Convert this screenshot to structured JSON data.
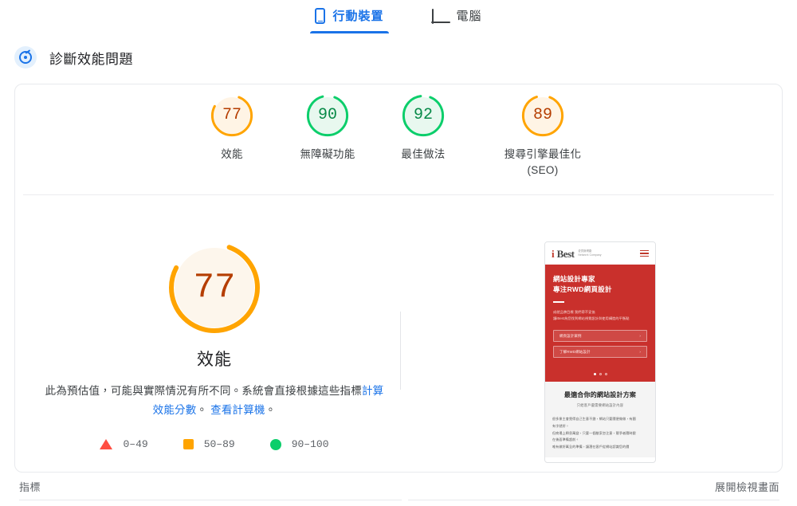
{
  "tabs": [
    {
      "label": "行動裝置",
      "icon": "mobile-icon",
      "active": true
    },
    {
      "label": "電腦",
      "icon": "desktop-icon",
      "active": false
    }
  ],
  "section": {
    "icon": "performance-gauge-icon",
    "title": "診斷效能問題"
  },
  "category_scores": [
    {
      "label": "效能",
      "value": "77",
      "color": "#ffa400",
      "fill": "#fff4e5",
      "text": "#b53d00"
    },
    {
      "label": "無障礙功能",
      "value": "90",
      "color": "#0cce6b",
      "fill": "#e8f8ef",
      "text": "#078a48"
    },
    {
      "label": "最佳做法",
      "value": "92",
      "color": "#0cce6b",
      "fill": "#e8f8ef",
      "text": "#078a48"
    },
    {
      "label": "搜尋引擎最佳化\n(SEO)",
      "value": "89",
      "color": "#ffa400",
      "fill": "#fff4e5",
      "text": "#b53d00"
    }
  ],
  "main_score": {
    "value": "77",
    "label": "效能",
    "color": "#ffa400",
    "fill": "#fdf6ec",
    "text": "#b53d00",
    "description_part1": "此為預估值，可能與實際情況有所不同。系統會直接根據這些指標",
    "description_link1": "計算效能分數",
    "description_mid": "。 ",
    "description_link2": "查看計算機",
    "description_end": "。"
  },
  "legend": [
    {
      "shape": "triangle",
      "color": "#ff4e42",
      "range": "0–49"
    },
    {
      "shape": "square",
      "color": "#ffa400",
      "range": "50–89"
    },
    {
      "shape": "circle",
      "color": "#0cce6b",
      "range": "90–100"
    }
  ],
  "screenshot_preview": {
    "logo_i": "i",
    "logo_best": "Best",
    "logo_sub_line1": "愛貝斯網路",
    "logo_sub_line2": "Network Company",
    "menu_icon": "hamburger-menu-icon",
    "hero_title_line1": "網站設計專家",
    "hero_title_line2": "專注RWD網頁設計",
    "hero_text_line1": "成就品牌目標 我們帶不妥協",
    "hero_text_line2": "讓iBest為您找到網站視覺設計與使用構造的平衡點",
    "buttons": [
      {
        "label": "網頁設計案例",
        "arrow": "›"
      },
      {
        "label": "了解RWD網站設計",
        "arrow": "›"
      }
    ],
    "carousel_dots": 3,
    "body_heading": "最適合你的網站設計方案",
    "body_subtitle": "只給客戶最需要網站設計內容",
    "body_text_line1": "很多業主會覺得自己生意不錯，網站只要隨便做做，有圖",
    "body_text_line2": "有字就好。",
    "body_text_line3": "但商場上瞬息萬變，只要一個敝家忽注意，競爭者隨時跟",
    "body_text_line4": "在後面準備超前。",
    "body_text_line5": "唯有做好萬全的準備，讓潛在客戶從網站認識您的價"
  },
  "footer": {
    "metrics_label": "指標",
    "expand_label": "展開檢視畫面"
  }
}
